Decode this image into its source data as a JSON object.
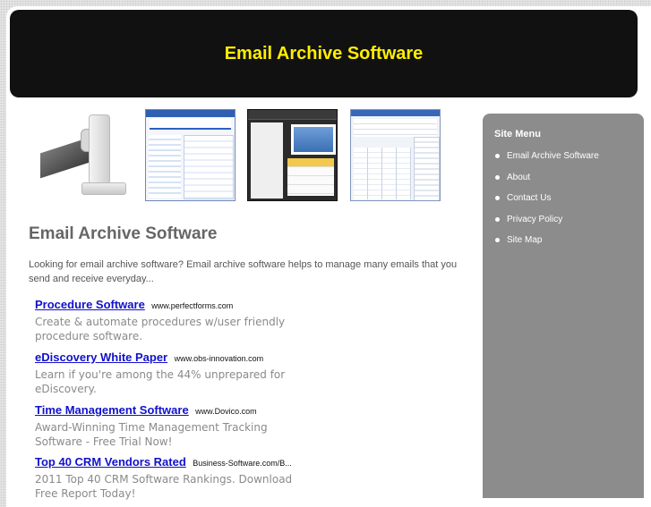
{
  "header": {
    "title": "Email Archive Software"
  },
  "images": [
    {
      "name": "mail-machine-image"
    },
    {
      "name": "mail-archiver-screenshot"
    },
    {
      "name": "dark-app-screenshot"
    },
    {
      "name": "archive-table-screenshot"
    }
  ],
  "main": {
    "title": "Email Archive Software",
    "intro": "Looking for email archive software? Email archive software helps to manage many emails that you send and receive everyday..."
  },
  "ads": [
    {
      "title": "Procedure Software",
      "url": "www.perfectforms.com",
      "desc": "Create & automate procedures w/user friendly procedure software."
    },
    {
      "title": "eDiscovery White Paper",
      "url": "www.obs-innovation.com",
      "desc": "Learn if you're among the 44% unprepared for eDiscovery."
    },
    {
      "title": "Time Management Software",
      "url": "www.Dovico.com",
      "desc": "Award-Winning Time Management Tracking Software - Free Trial Now!"
    },
    {
      "title": "Top 40 CRM Vendors Rated",
      "url": "Business-Software.com/B...",
      "desc": "2011 Top 40 CRM Software Rankings. Download Free Report Today!"
    }
  ],
  "sidebar": {
    "title": "Site Menu",
    "items": [
      {
        "label": "Email Archive Software"
      },
      {
        "label": "About"
      },
      {
        "label": "Contact Us"
      },
      {
        "label": "Privacy Policy"
      },
      {
        "label": "Site Map"
      }
    ]
  }
}
